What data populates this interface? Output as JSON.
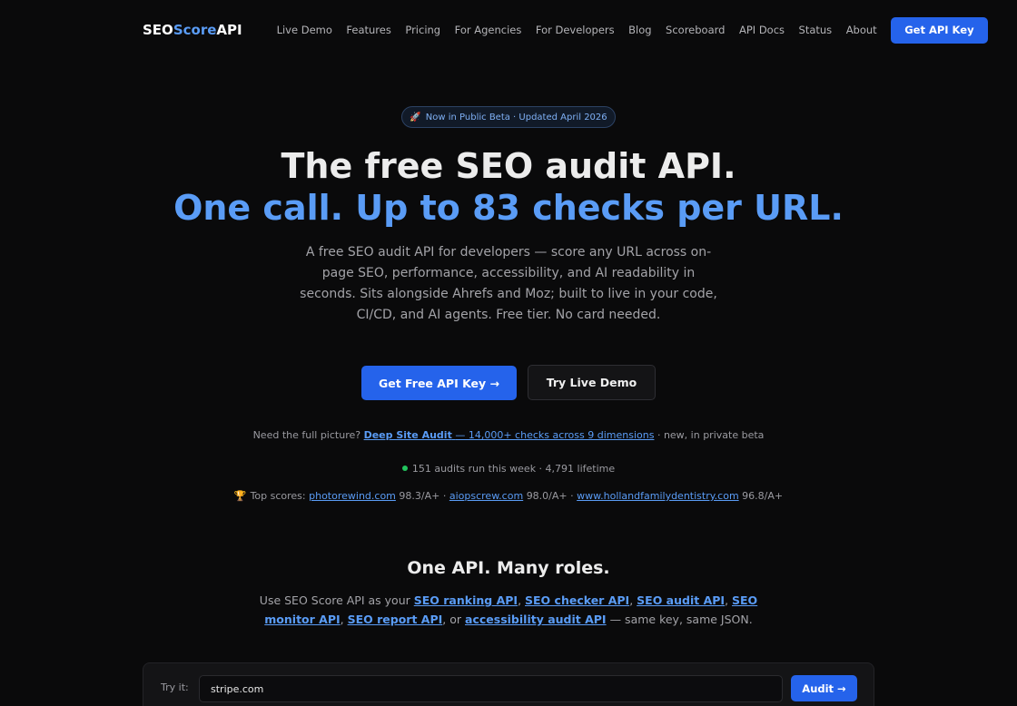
{
  "nav": {
    "logo_main": "SEO",
    "logo_accent": "Score",
    "logo_tail": "API",
    "links": [
      "Live Demo",
      "Features",
      "Pricing",
      "For Agencies",
      "For Developers",
      "Blog",
      "Scoreboard",
      "API Docs",
      "Status",
      "About"
    ],
    "cta": "Get API Key"
  },
  "hero": {
    "badge_icon": "rocket-icon",
    "badge_text": "Now in Public Beta · Updated April 2026",
    "headline": "The free SEO audit API.",
    "headline_accent": "One call. Up to 83 checks per URL.",
    "lede": "A free SEO audit API for developers — score any URL across on-page SEO, performance, accessibility, and AI readability in seconds. Sits alongside Ahrefs and Moz; built to live in your code, CI/CD, and AI agents. Free tier. No card needed.",
    "primary_button": "Get Free API Key →",
    "secondary_button": "Try Live Demo"
  },
  "full_picture": {
    "prefix": "Need the full picture?",
    "link_bold": "Deep Site Audit",
    "link_rest": "— 14,000+ checks across 9 dimensions",
    "suffix": "· new, in private beta"
  },
  "stats": {
    "status_color": "#22c55e",
    "text": "151 audits run this week · 4,791 lifetime"
  },
  "top_scores": {
    "icon": "trophy-icon",
    "label": "Top scores:",
    "entries": [
      {
        "site": "photorewind.com",
        "score": "98.3/A+"
      },
      {
        "site": "aiopscrew.com",
        "score": "98.0/A+"
      },
      {
        "site": "www.hollandfamilydentistry.com",
        "score": "96.8/A+"
      }
    ],
    "separator": "·"
  },
  "roles": {
    "title": "One API. Many roles.",
    "prefix": "Use SEO Score API as your",
    "links": [
      "SEO ranking API",
      "SEO checker API",
      "SEO audit API",
      "SEO monitor API",
      "SEO report API",
      "accessibility audit API"
    ],
    "or_word": "or",
    "suffix": "— same key, same JSON."
  },
  "try_it": {
    "label": "Try it:",
    "value": "stripe.com",
    "button": "Audit →"
  },
  "colors": {
    "accent": "#5a9cf6",
    "button": "#2563eb",
    "background": "#0a0a0b"
  }
}
